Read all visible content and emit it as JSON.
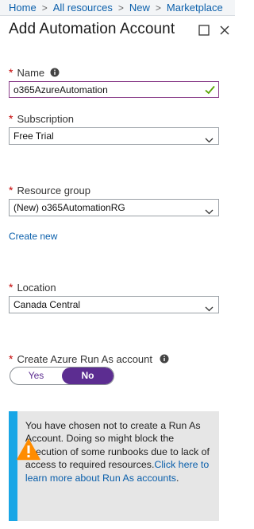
{
  "breadcrumb": [
    "Home",
    "All resources",
    "New",
    "Marketplace"
  ],
  "title": "Add Automation Account",
  "icons": {
    "restore": "maximize-icon",
    "close": "close-icon",
    "info": "info-icon",
    "valid": "checkmark-icon",
    "dropdown": "chevron-down-icon",
    "warning": "warning-triangle-icon"
  },
  "required_marker": "*",
  "fields": {
    "name": {
      "label": "Name",
      "value": "o365AzureAutomation"
    },
    "subscription": {
      "label": "Subscription",
      "value": "Free Trial"
    },
    "resource_group": {
      "label": "Resource group",
      "value": "(New) o365AutomationRG"
    },
    "location": {
      "label": "Location",
      "value": "Canada Central"
    },
    "run_as": {
      "label": "Create Azure Run As account",
      "options": [
        "Yes",
        "No"
      ],
      "selected": "No"
    }
  },
  "create_new_link": "Create new",
  "warning": {
    "message": "You have chosen not to create a Run As Account. Doing so might block the execution of some runbooks due to lack of access to required resources.",
    "link": "Click here to learn more about Run As accounts",
    "link_suffix": "."
  },
  "colors": {
    "accent": "#5c2d91",
    "link": "#0a5fab",
    "required": "#c30000",
    "valid": "#57a300",
    "warning_strip": "#18a6e6",
    "warning_icon": "#ff8c00",
    "warning_bg": "#e6e6e6"
  }
}
